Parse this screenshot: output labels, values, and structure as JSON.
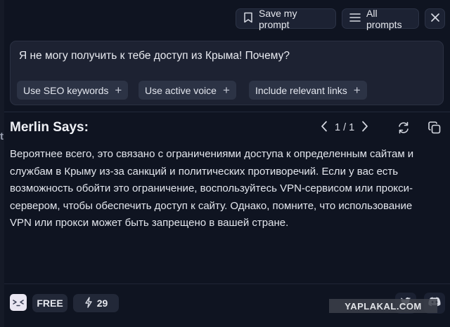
{
  "toolbar": {
    "save_prompt_label": "Save my prompt",
    "all_prompts_label": "All prompts"
  },
  "prompt": {
    "text": "Я не могу получить к тебе доступ из Крыма! Почему?",
    "chips": [
      "Use SEO keywords",
      "Use active voice",
      "Include relevant links"
    ]
  },
  "response": {
    "title": "Merlin Says:",
    "page_current": "1",
    "page_total": "1",
    "answer": "Вероятнее всего, это связано с ограничениями доступа к определенным сайтам и службам в Крыму из-за санкций и политических противоречий. Если у вас есть возможность обойти это ограничение, воспользуйтесь VPN-сервисом или прокси-сервером, чтобы обеспечить доступ к сайту. Однако, помните, что использование VPN или прокси может быть запрещено в вашей стране."
  },
  "footer": {
    "plan_label": "FREE",
    "credits": "29"
  },
  "watermark": "YAPLAKAL.COM",
  "left_glyph": "t"
}
